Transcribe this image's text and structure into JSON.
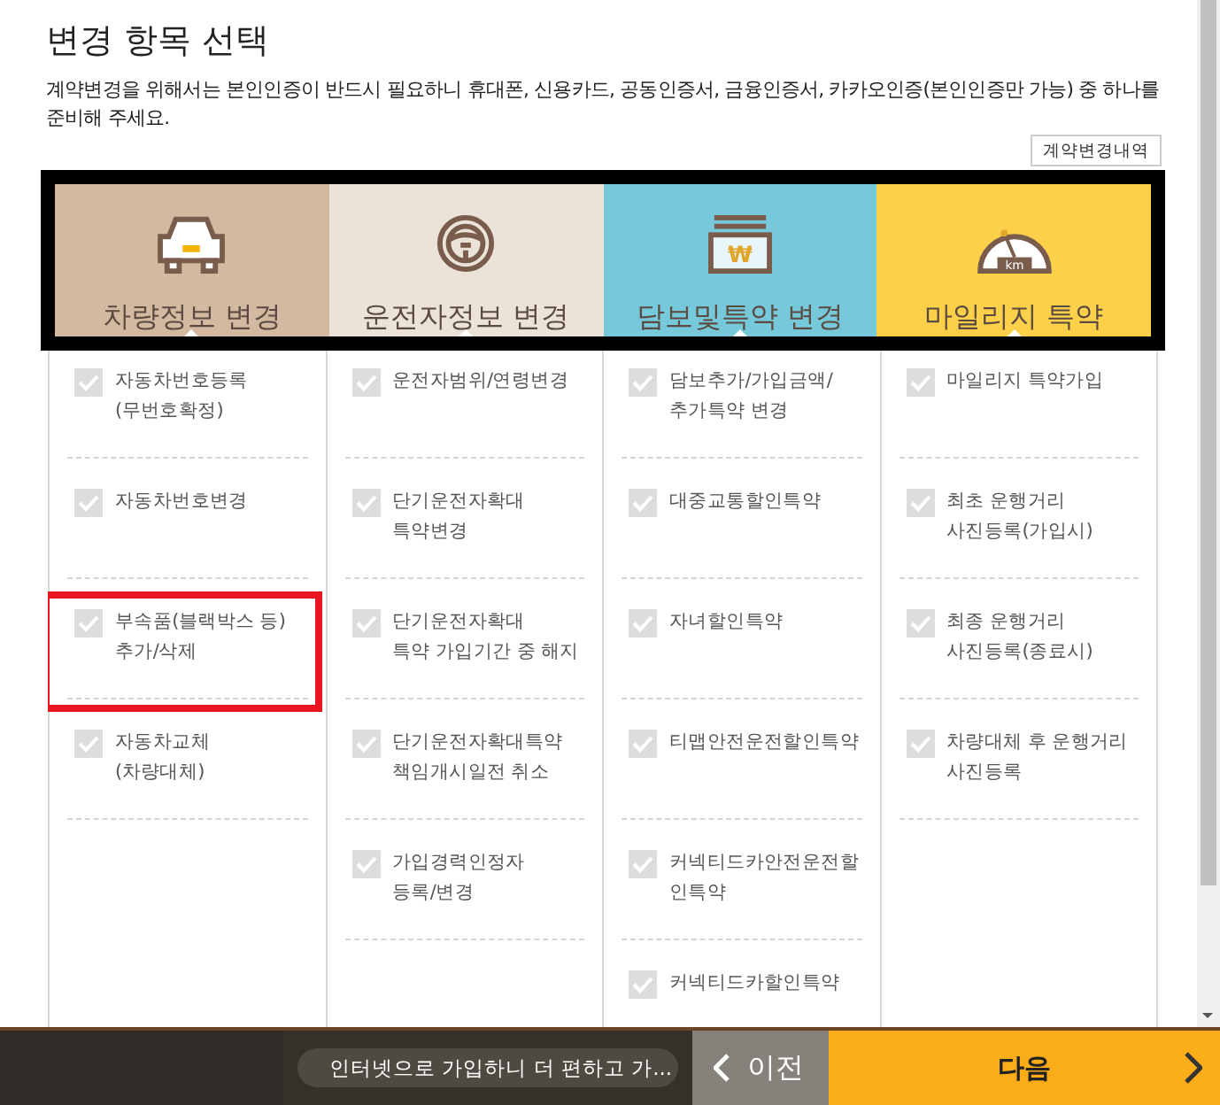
{
  "title": "변경 항목 선택",
  "description": "계약변경을 위해서는 본인인증이 반드시 필요하니 휴대폰, 신용카드, 공동인증서, 금융인증서, 카카오인증(본인인증만 가능) 중 하나를 준비해 주세요.",
  "history_button": "계약변경내역",
  "tabs_highlighted": true,
  "tabs": [
    {
      "label": "차량정보 변경",
      "kind": "car",
      "color": "#d3b9a0"
    },
    {
      "label": "운전자정보 변경",
      "kind": "wheel",
      "color": "#ebe3d8"
    },
    {
      "label": "담보및특약 변경",
      "kind": "money",
      "icon_text": "₩",
      "color": "#76c9da"
    },
    {
      "label": "마일리지 특약",
      "kind": "gauge",
      "icon_text": "km",
      "color": "#fdd04a"
    }
  ],
  "columns": [
    {
      "items": [
        {
          "label": "자동차번호등록\n(무번호확정)",
          "highlighted": false
        },
        {
          "label": "자동차번호변경",
          "highlighted": false
        },
        {
          "label": "부속품(블랙박스 등)\n추가/삭제",
          "highlighted": true
        },
        {
          "label": "자동차교체\n(차량대체)",
          "highlighted": false
        }
      ]
    },
    {
      "items": [
        {
          "label": "운전자범위/연령변경",
          "highlighted": false
        },
        {
          "label": "단기운전자확대\n특약변경",
          "highlighted": false
        },
        {
          "label": "단기운전자확대\n특약 가입기간 중 해지",
          "highlighted": false
        },
        {
          "label": "단기운전자확대특약\n책임개시일전 취소",
          "highlighted": false
        },
        {
          "label": "가입경력인정자\n등록/변경",
          "highlighted": false
        }
      ]
    },
    {
      "items": [
        {
          "label": "담보추가/가입금액/\n추가특약 변경",
          "highlighted": false
        },
        {
          "label": "대중교통할인특약",
          "highlighted": false
        },
        {
          "label": "자녀할인특약",
          "highlighted": false
        },
        {
          "label": "티맵안전운전할인특약",
          "highlighted": false
        },
        {
          "label": "커넥티드카안전운전할\n인특약",
          "highlighted": false
        },
        {
          "label": "커넥티드카할인특약",
          "highlighted": false
        }
      ]
    },
    {
      "items": [
        {
          "label": "마일리지 특약가입",
          "highlighted": false
        },
        {
          "label": "최초 운행거리\n사진등록(가입시)",
          "highlighted": false
        },
        {
          "label": "최종 운행거리\n사진등록(종료시)",
          "highlighted": false
        },
        {
          "label": "차량대체 후 운행거리\n사진등록",
          "highlighted": false
        }
      ]
    }
  ],
  "footer": {
    "chat": "인터넷으로 가입하니 더 편하고 가...",
    "prev": "이전",
    "next": "다음"
  }
}
